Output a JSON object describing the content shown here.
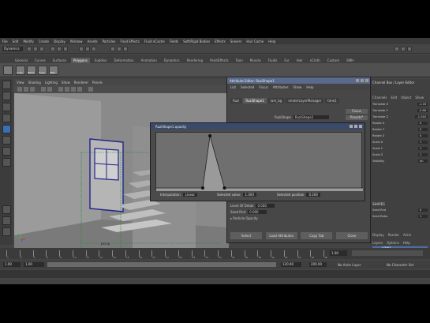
{
  "menubar": [
    "File",
    "Edit",
    "Modify",
    "Create",
    "Display",
    "Window",
    "Assets",
    "Particles",
    "Fluid Effects",
    "Fluid nCache",
    "Fields",
    "Soft/Rigid Bodies",
    "Effects",
    "Solvers",
    "Hair Cache",
    "Help"
  ],
  "status": {
    "mode": "Dynamics"
  },
  "shelf_tabs": [
    {
      "label": "General",
      "active": false
    },
    {
      "label": "Curves",
      "active": false
    },
    {
      "label": "Surfaces",
      "active": false
    },
    {
      "label": "Polygons",
      "active": true
    },
    {
      "label": "Subdivs",
      "active": false
    },
    {
      "label": "Deformation",
      "active": false
    },
    {
      "label": "Animation",
      "active": false
    },
    {
      "label": "Dynamics",
      "active": false
    },
    {
      "label": "Rendering",
      "active": false
    },
    {
      "label": "PaintEffects",
      "active": false
    },
    {
      "label": "Toon",
      "active": false
    },
    {
      "label": "Muscle",
      "active": false
    },
    {
      "label": "Fluids",
      "active": false
    },
    {
      "label": "Fur",
      "active": false
    },
    {
      "label": "Hair",
      "active": false
    },
    {
      "label": "nCloth",
      "active": false
    },
    {
      "label": "Custom",
      "active": false
    },
    {
      "label": "SMH",
      "active": false
    }
  ],
  "shelf_labels": [
    "Cube",
    "BOOL",
    "Cube",
    "SMO"
  ],
  "panel_menu": [
    "View",
    "Shading",
    "Lighting",
    "Show",
    "Renderer",
    "Panels"
  ],
  "viewport": {
    "label": "persp"
  },
  "channel_box": {
    "title": "Channel Box / Layer Editor",
    "tabs": [
      "Channels",
      "Edit",
      "Object",
      "Show"
    ],
    "attrs": [
      {
        "name": "Translate X",
        "value": "-1.16"
      },
      {
        "name": "Translate Y",
        "value": "-2.66"
      },
      {
        "name": "Translate Z",
        "value": "-1.244"
      },
      {
        "name": "Rotate X",
        "value": "0"
      },
      {
        "name": "Rotate Y",
        "value": "0"
      },
      {
        "name": "Rotate Z",
        "value": "0"
      },
      {
        "name": "Scale X",
        "value": "1"
      },
      {
        "name": "Scale Y",
        "value": "1"
      },
      {
        "name": "Scale Z",
        "value": "1"
      },
      {
        "name": "Visibility",
        "value": "on"
      }
    ],
    "shapes_label": "SHAPES",
    "shape_attrs": [
      {
        "name": "Seed Rnd",
        "value": "0"
      },
      {
        "name": "Seed Ratio",
        "value": "1"
      }
    ],
    "layer_tabs": [
      "Display",
      "Render",
      "Anim"
    ],
    "layer_menu": [
      "Layers",
      "Options",
      "Help"
    ],
    "layer_name": "LOW1"
  },
  "attribute_editor": {
    "title": "Attribute Editor: RuziShape1",
    "menu": [
      "List",
      "Selected",
      "Focus",
      "Attributes",
      "Show",
      "Help"
    ],
    "tabs": [
      {
        "label": "Ruzi",
        "active": false
      },
      {
        "label": "RuziShape1",
        "active": true
      },
      {
        "label": "lam_bg",
        "active": false
      },
      {
        "label": "renderLayerManager",
        "active": false
      },
      {
        "label": "time1",
        "active": false
      }
    ],
    "type_label": "RuziShape",
    "type_value": "RuziShape1",
    "focus_btn": "Focus",
    "presets_btn": "Presets*",
    "rows": [
      {
        "label": "Level Of Detail",
        "value": "0.000"
      },
      {
        "label": "Seed Rnd",
        "value": "0.000"
      }
    ],
    "section": "Particle Opacity",
    "bottom_buttons": [
      "Select",
      "Load Attributes",
      "Copy Tab",
      "Close"
    ]
  },
  "ramp_window": {
    "title": "RuziShape1.opacity",
    "interpolation_label": "Interpolation",
    "interpolation_value": "Linear",
    "selected_value_label": "Selected value",
    "selected_value": "1.000",
    "selected_position_label": "Selected position",
    "selected_position": "0.260",
    "curve_points": [
      [
        0,
        0
      ],
      [
        0.225,
        0
      ],
      [
        0.26,
        1
      ],
      [
        0.33,
        0
      ],
      [
        1,
        0
      ]
    ]
  },
  "timeline": {
    "ticks": [
      "1",
      "2",
      "4",
      "6",
      "8",
      "10",
      "12",
      "14",
      "16",
      "18",
      "20",
      "22",
      "24",
      "26",
      "28",
      "30",
      "32",
      "34",
      "36",
      "38",
      "40",
      "42",
      "44",
      "46",
      "48"
    ],
    "current": "1.00"
  },
  "range": {
    "start": "1.00",
    "inner_start": "1.00",
    "inner_end": "120.00",
    "end": "120.00",
    "end2": "200.00",
    "anim_layer": "No Anim Layer",
    "char_set": "No Character Set"
  }
}
